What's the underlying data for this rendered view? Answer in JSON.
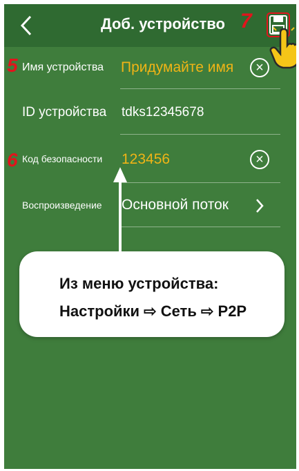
{
  "header": {
    "title": "Доб. устройство",
    "back_icon": "chevron-left-icon",
    "save_icon": "floppy-disk-icon",
    "step_number": "7"
  },
  "form": {
    "device_name": {
      "step": "5",
      "label": "Имя устройства",
      "placeholder": "Придумайте имя"
    },
    "device_id": {
      "label": "ID устройства",
      "value": "tdks12345678"
    },
    "security_code": {
      "step": "6",
      "label": "Код безопасности",
      "value": "123456"
    },
    "playback": {
      "label": "Воспроизведение",
      "value": "Основной поток"
    }
  },
  "callout": {
    "line1": "Из меню устройства:",
    "line2": "Настройки ⇨ Сеть ⇨ P2P"
  },
  "colors": {
    "background": "#3f7d3c",
    "topbar": "#2f6a31",
    "accent_yellow": "#f0b416",
    "step_red": "#e1141c"
  }
}
